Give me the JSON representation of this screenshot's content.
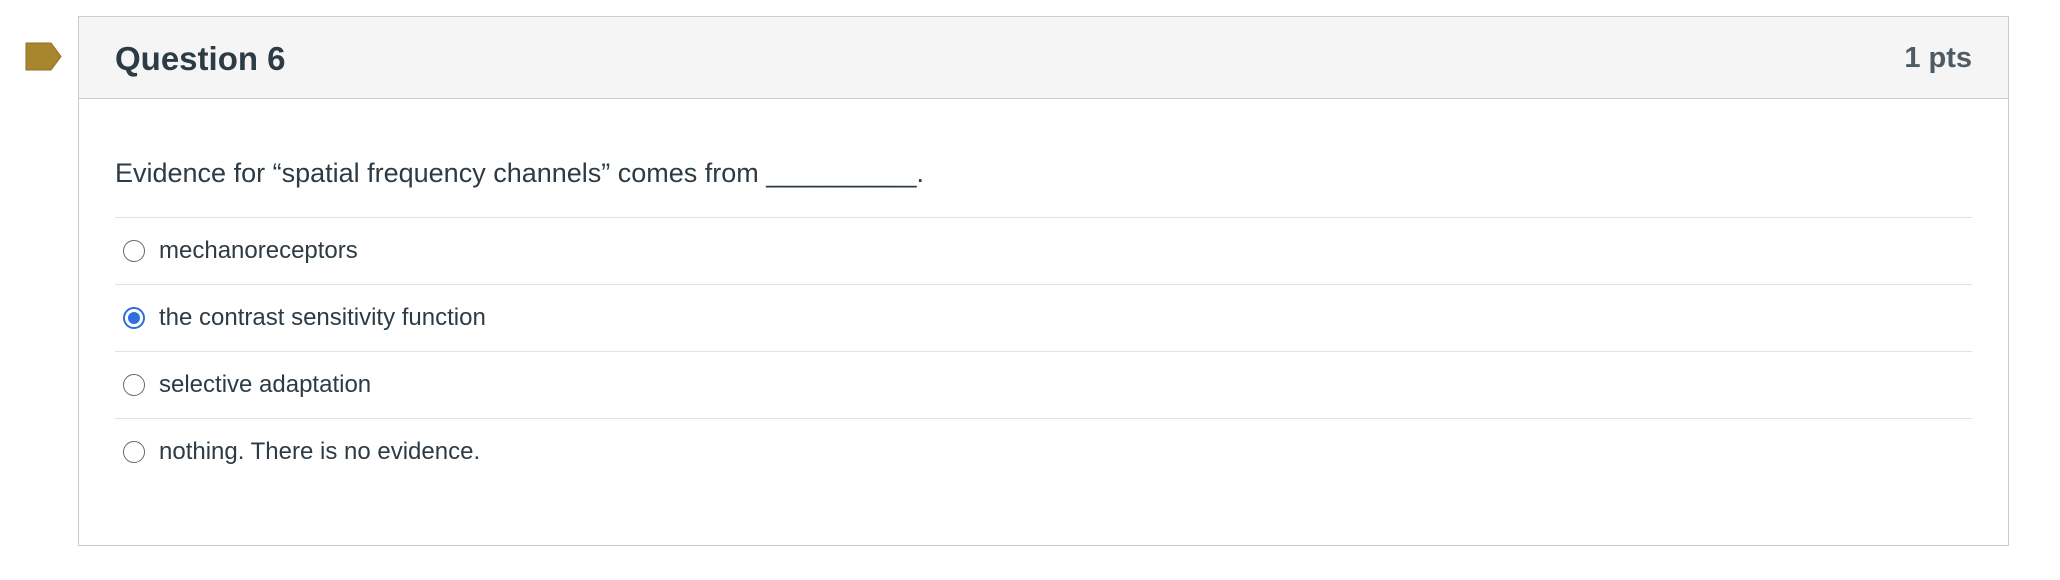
{
  "question": {
    "title": "Question 6",
    "points": "1 pts",
    "text": "Evidence for “spatial frequency channels” comes from __________.",
    "flag_icon": "bookmark-flag-icon",
    "flag_color": "#a8862e",
    "answers": [
      {
        "label": "mechanoreceptors",
        "selected": false
      },
      {
        "label": "the contrast sensitivity function",
        "selected": true
      },
      {
        "label": "selective adaptation",
        "selected": false
      },
      {
        "label": "nothing. There is no evidence.",
        "selected": false
      }
    ]
  },
  "colors": {
    "header_bg": "#f5f5f5",
    "border": "#c7cdd1",
    "text": "#2d3b45",
    "radio_selected": "#2d6ee0"
  }
}
